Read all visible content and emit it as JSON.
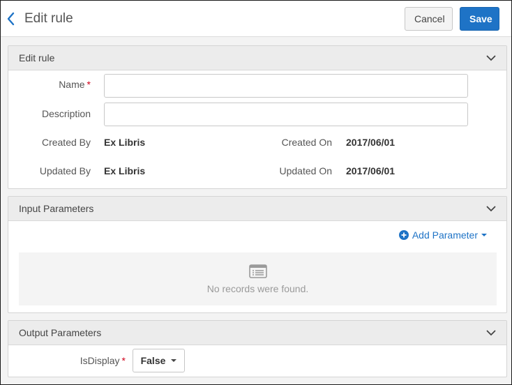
{
  "header": {
    "title": "Edit rule",
    "cancel_label": "Cancel",
    "save_label": "Save"
  },
  "edit_rule": {
    "title": "Edit rule",
    "name_label": "Name",
    "name_value": "",
    "description_label": "Description",
    "description_value": "",
    "created_by_label": "Created By",
    "created_by_value": "Ex Libris",
    "created_on_label": "Created On",
    "created_on_value": "2017/06/01",
    "updated_by_label": "Updated By",
    "updated_by_value": "Ex Libris",
    "updated_on_label": "Updated On",
    "updated_on_value": "2017/06/01"
  },
  "input_parameters": {
    "title": "Input Parameters",
    "add_label": "Add Parameter",
    "empty_text": "No records were found."
  },
  "output_parameters": {
    "title": "Output Parameters",
    "isdisplay_label": "IsDisplay",
    "isdisplay_value": "False"
  },
  "colors": {
    "accent": "#1e73c6",
    "required": "#d0021b"
  },
  "icons": {
    "back": "chevron-left-icon",
    "collapse": "chevron-down-icon",
    "add": "plus-circle-icon",
    "empty": "list-icon"
  }
}
